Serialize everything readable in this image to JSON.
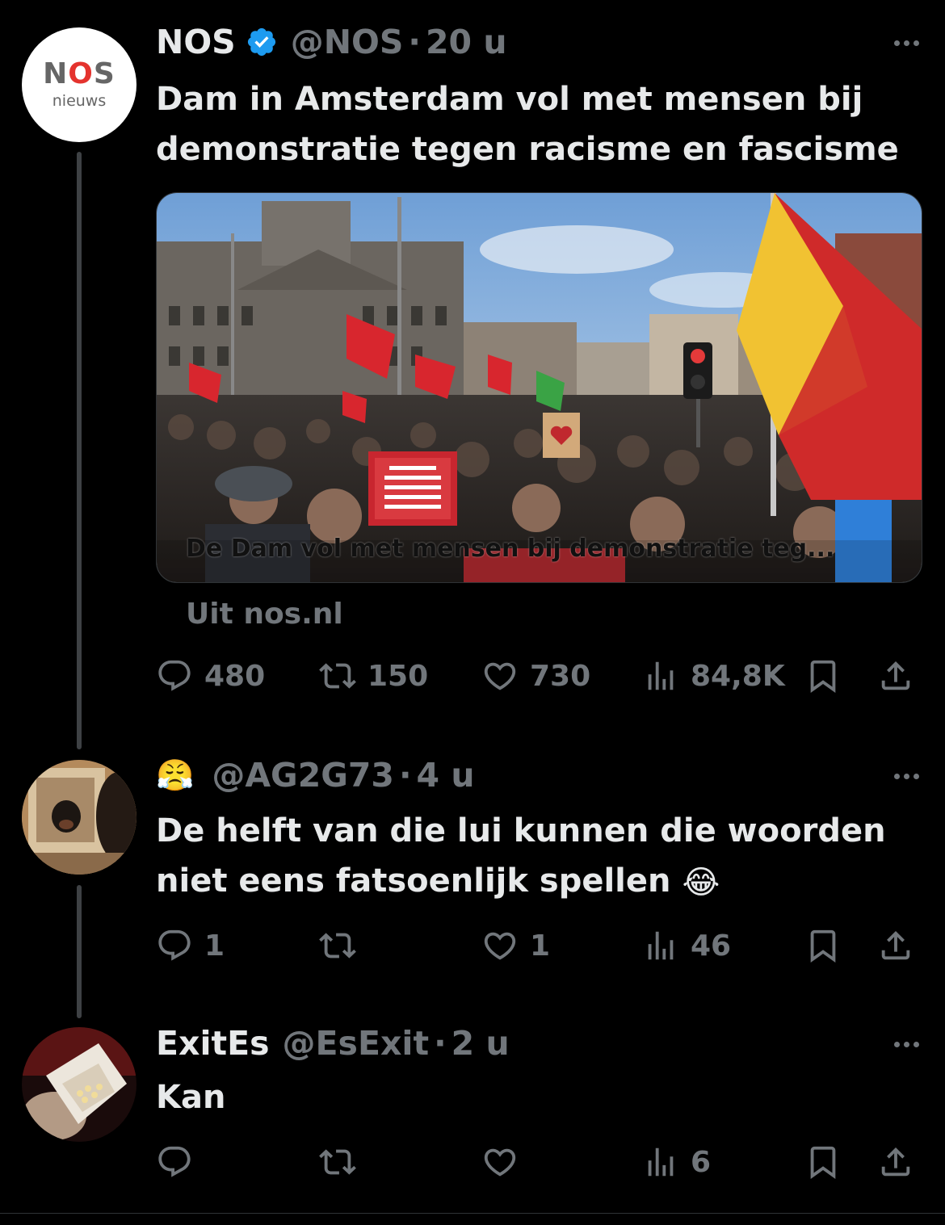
{
  "posts": [
    {
      "name": "NOS",
      "handle": "@NOS",
      "sep": "·",
      "time": "20 u",
      "text": "Dam in Amsterdam vol met mensen bij demonstratie tegen racisme en fascisme",
      "avatar": {
        "logo_letters": [
          "N",
          "O",
          "S"
        ],
        "sub": "nieuws"
      },
      "media": {
        "caption": "De Dam vol met mensen bij demonstratie teg..."
      },
      "source": "Uit nos.nl",
      "stats": {
        "replies": "480",
        "reposts": "150",
        "likes": "730",
        "views": "84,8K"
      }
    },
    {
      "name": "",
      "name_emoji": "😤",
      "handle": "@AG2G73",
      "sep": "·",
      "time": "4 u",
      "text": "De helft van die lui kunnen die woorden niet eens fatsoenlijk spellen",
      "text_emoji": "😂",
      "stats": {
        "replies": "1",
        "reposts": "",
        "likes": "1",
        "views": "46"
      }
    },
    {
      "name": "ExitEs",
      "handle": "@EsExit",
      "sep": "·",
      "time": "2 u",
      "text": "Kan",
      "stats": {
        "replies": "",
        "reposts": "",
        "likes": "",
        "views": "6"
      }
    }
  ],
  "icons": [
    "verified-badge-icon",
    "more-icon",
    "reply-icon",
    "repost-icon",
    "like-icon",
    "views-icon",
    "bookmark-icon",
    "share-icon"
  ],
  "colors": {
    "background": "#000000",
    "text": "#e7e9ea",
    "muted": "#71767b",
    "verified": "#1d9bf0",
    "thread_line": "#3e4144"
  }
}
